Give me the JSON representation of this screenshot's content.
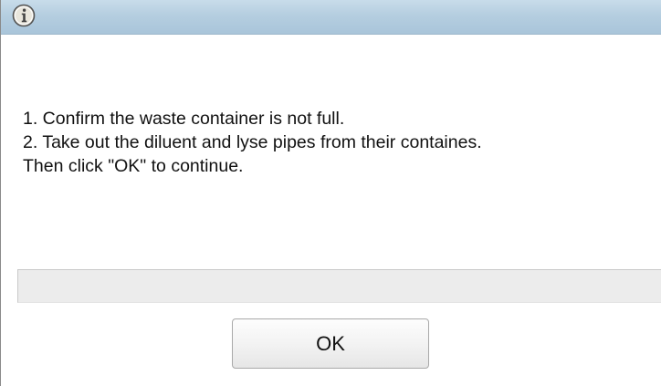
{
  "dialog": {
    "title_icon": "info-icon",
    "message_lines": [
      "1. Confirm the waste container is not full.",
      "2. Take out the diluent and lyse pipes from their containes.",
      "Then click \"OK\" to continue."
    ],
    "progress": 0,
    "ok_label": "OK"
  },
  "colors": {
    "titlebar": "#b5cee0",
    "icon_fill": "#e9e6dc",
    "icon_stroke": "#555555",
    "progress_track": "#ececec"
  }
}
